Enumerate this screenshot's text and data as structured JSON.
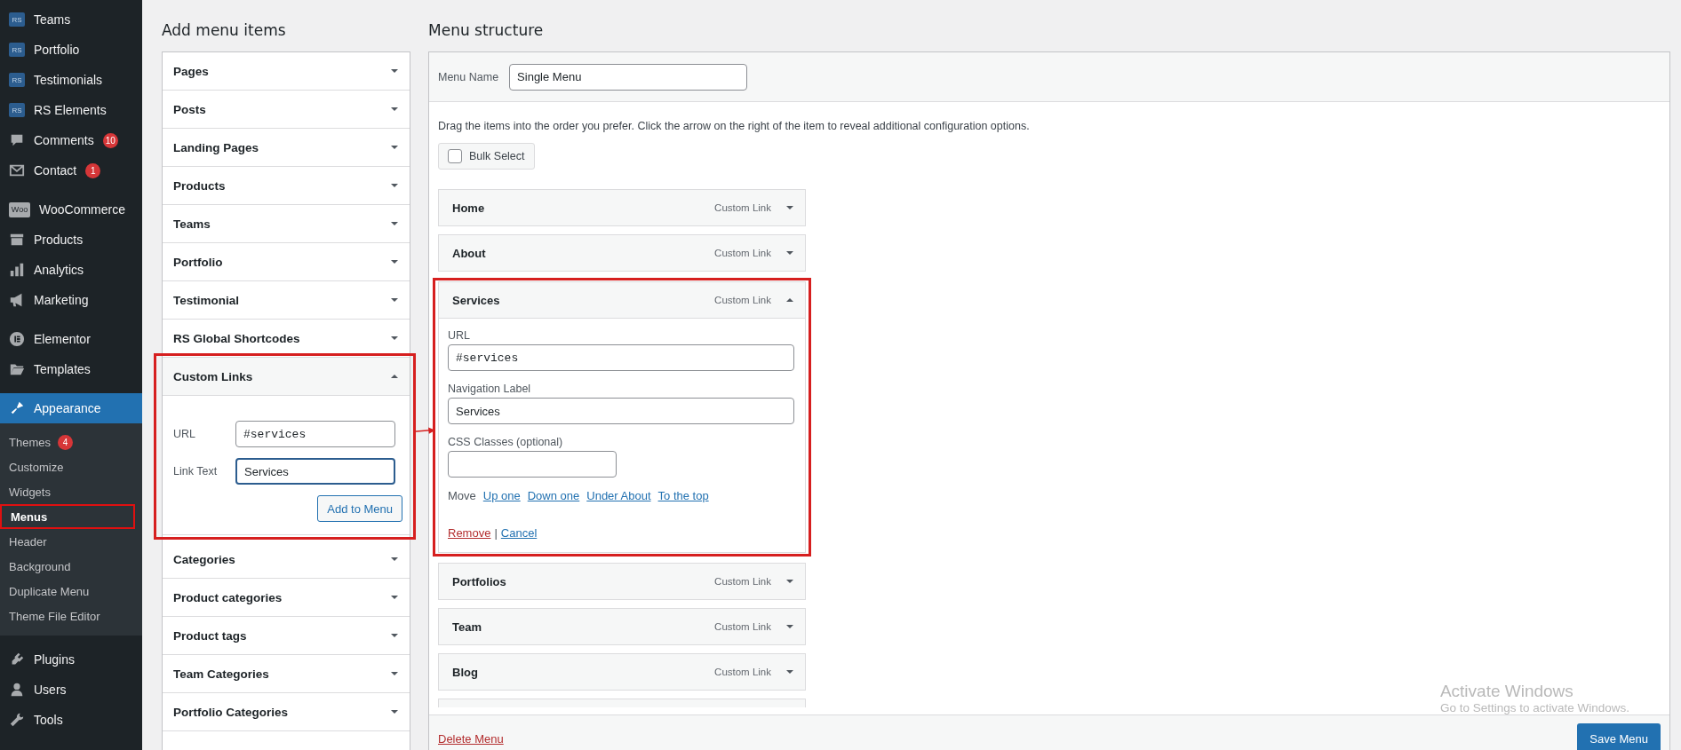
{
  "sidebar": {
    "groups": [
      {
        "items": [
          {
            "label": "Teams",
            "icon_text": "RS",
            "selected": false
          },
          {
            "label": "Portfolio",
            "icon_text": "RS",
            "selected": false
          },
          {
            "label": "Testimonials",
            "icon_text": "RS",
            "selected": false
          },
          {
            "label": "RS Elements",
            "icon_text": "RS",
            "selected": false
          },
          {
            "label": "Comments",
            "badge": "10",
            "selected": false
          },
          {
            "label": "Contact",
            "badge": "1",
            "selected": false
          }
        ]
      },
      {
        "items": [
          {
            "label": "WooCommerce",
            "icon_text": "Woo",
            "selected": false
          },
          {
            "label": "Products",
            "selected": false
          },
          {
            "label": "Analytics",
            "selected": false
          },
          {
            "label": "Marketing",
            "selected": false
          }
        ]
      },
      {
        "items": [
          {
            "label": "Elementor",
            "selected": false
          },
          {
            "label": "Templates",
            "selected": false
          },
          {
            "label": "Appearance",
            "selected": true,
            "children": [
              {
                "label": "Themes",
                "badge": "4",
                "selected": false,
                "highlighted": false
              },
              {
                "label": "Customize",
                "selected": false,
                "highlighted": false
              },
              {
                "label": "Widgets",
                "selected": false,
                "highlighted": false
              },
              {
                "label": "Menus",
                "selected": true,
                "highlighted": true
              },
              {
                "label": "Header",
                "selected": false,
                "highlighted": false
              },
              {
                "label": "Background",
                "selected": false,
                "highlighted": false
              },
              {
                "label": "Duplicate Menu",
                "selected": false,
                "highlighted": false
              },
              {
                "label": "Theme File Editor",
                "selected": false,
                "highlighted": false
              }
            ]
          }
        ]
      },
      {
        "items": [
          {
            "label": "Plugins",
            "selected": false
          },
          {
            "label": "Users",
            "selected": false
          },
          {
            "label": "Tools",
            "selected": false
          }
        ]
      }
    ]
  },
  "add_menu_items": {
    "title": "Add menu items",
    "sections": [
      {
        "label": "Pages",
        "expanded": false
      },
      {
        "label": "Posts",
        "expanded": false
      },
      {
        "label": "Landing Pages",
        "expanded": false
      },
      {
        "label": "Products",
        "expanded": false
      },
      {
        "label": "Teams",
        "expanded": false
      },
      {
        "label": "Portfolio",
        "expanded": false
      },
      {
        "label": "Testimonial",
        "expanded": false
      },
      {
        "label": "RS Global Shortcodes",
        "expanded": false
      },
      {
        "label": "Custom Links",
        "expanded": true,
        "highlighted": true,
        "url_label": "URL",
        "url_value": "#services",
        "text_label": "Link Text",
        "text_value": "Services",
        "button": "Add to Menu"
      },
      {
        "label": "Categories",
        "expanded": false
      },
      {
        "label": "Product categories",
        "expanded": false
      },
      {
        "label": "Product tags",
        "expanded": false
      },
      {
        "label": "Team Categories",
        "expanded": false
      },
      {
        "label": "Portfolio Categories",
        "expanded": false
      }
    ]
  },
  "menu_structure": {
    "title": "Menu structure",
    "menu_name_label": "Menu Name",
    "menu_name_value": "Single Menu",
    "instructions": "Drag the items into the order you prefer. Click the arrow on the right of the item to reveal additional configuration options.",
    "bulk_select": {
      "label": "Bulk Select",
      "checked": false
    },
    "items": [
      {
        "title": "Home",
        "type": "Custom Link",
        "expanded": false
      },
      {
        "title": "About",
        "type": "Custom Link",
        "expanded": false
      },
      {
        "title": "Services",
        "type": "Custom Link",
        "expanded": true,
        "highlighted": true,
        "url_label": "URL",
        "url_value": "#services",
        "nav_label": "Navigation Label",
        "nav_value": "Services",
        "css_label": "CSS Classes (optional)",
        "move_label": "Move",
        "move_links": [
          "Up one",
          "Down one",
          "Under About",
          "To the top"
        ],
        "remove": "Remove",
        "separator": "|",
        "cancel": "Cancel"
      },
      {
        "title": "Portfolios",
        "type": "Custom Link",
        "expanded": false
      },
      {
        "title": "Team",
        "type": "Custom Link",
        "expanded": false
      },
      {
        "title": "Blog",
        "type": "Custom Link",
        "expanded": false
      },
      {
        "expanded": false
      }
    ],
    "delete": "Delete Menu",
    "save": "Save Menu"
  },
  "os_notice": {
    "title": "Activate Windows",
    "text": "Go to Settings to activate Windows."
  }
}
